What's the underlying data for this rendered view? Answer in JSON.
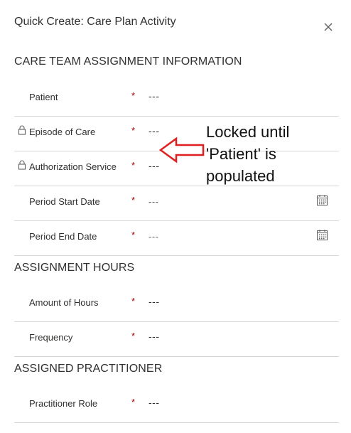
{
  "header": {
    "title": "Quick Create: Care Plan Activity",
    "close_icon": "close-icon"
  },
  "sections": [
    {
      "title": "CARE TEAM ASSIGNMENT INFORMATION",
      "fields": [
        {
          "label": "Patient",
          "required": "*",
          "value": "---",
          "locked": false
        },
        {
          "label": "Episode of Care",
          "required": "*",
          "value": "---",
          "locked": true
        },
        {
          "label": "Authorization Service",
          "required": "*",
          "value": "---",
          "locked": true
        },
        {
          "label": "Period Start Date",
          "required": "*",
          "value": "---",
          "icon": "calendar-icon"
        },
        {
          "label": "Period End Date",
          "required": "*",
          "value": "---",
          "icon": "calendar-icon"
        }
      ]
    },
    {
      "title": "ASSIGNMENT HOURS",
      "fields": [
        {
          "label": "Amount of Hours",
          "required": "*",
          "value": "---"
        },
        {
          "label": "Frequency",
          "required": "*",
          "value": "---"
        }
      ]
    },
    {
      "title": "ASSIGNED PRACTITIONER",
      "fields": [
        {
          "label": "Practitioner Role",
          "required": "*",
          "value": "---"
        }
      ]
    }
  ],
  "annotation": {
    "text": "Locked until\n'Patient' is\npopulated",
    "arrow_color": "#e02020",
    "arrow_icon": "left-arrow-icon"
  },
  "colors": {
    "required": "#a80000",
    "divider": "#d8d8d8",
    "text": "#323130"
  }
}
